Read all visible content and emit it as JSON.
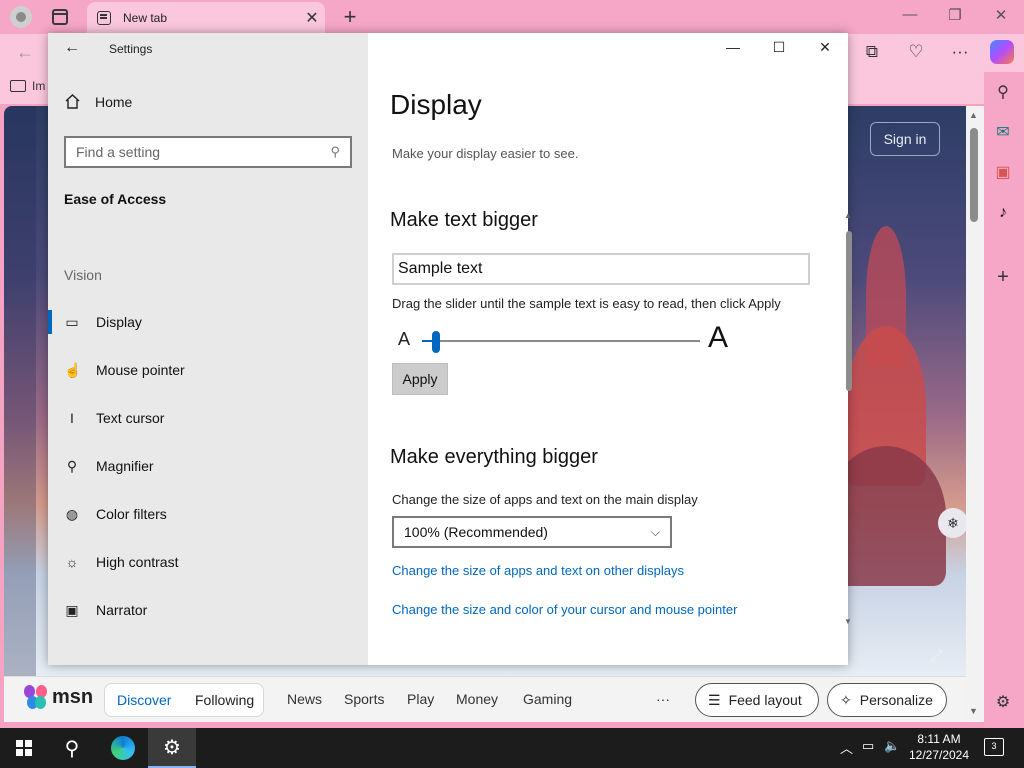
{
  "browser": {
    "tab_title": "New tab",
    "fav_label": "Im",
    "signin_label": "Sign in"
  },
  "msn": {
    "logo": "msn",
    "segments": [
      "Discover",
      "Following"
    ],
    "nav": [
      "News",
      "Sports",
      "Play",
      "Money",
      "Gaming"
    ],
    "more": "···",
    "feed_layout": "Feed layout",
    "personalize": "Personalize"
  },
  "settings": {
    "window_title": "Settings",
    "home_label": "Home",
    "search_placeholder": "Find a setting",
    "section": "Ease of Access",
    "group": "Vision",
    "nav_items": [
      {
        "label": "Display",
        "icon": "monitor-icon",
        "active": true
      },
      {
        "label": "Mouse pointer",
        "icon": "mouse-pointer-icon"
      },
      {
        "label": "Text cursor",
        "icon": "text-cursor-icon"
      },
      {
        "label": "Magnifier",
        "icon": "magnifier-icon"
      },
      {
        "label": "Color filters",
        "icon": "palette-icon"
      },
      {
        "label": "High contrast",
        "icon": "sun-icon"
      },
      {
        "label": "Narrator",
        "icon": "narrator-icon"
      }
    ],
    "page_title": "Display",
    "page_subtitle": "Make your display easier to see.",
    "text_bigger_heading": "Make text bigger",
    "sample_text": "Sample text",
    "slider_hint": "Drag the slider until the sample text is easy to read, then click Apply",
    "slider_small": "A",
    "slider_big": "A",
    "slider_value_fraction": 0.05,
    "apply_label": "Apply",
    "everything_bigger_heading": "Make everything bigger",
    "main_display_label": "Change the size of apps and text on the main display",
    "scale_value": "100% (Recommended)",
    "link_other_displays": "Change the size of apps and text on other displays",
    "link_cursor": "Change the size and color of your cursor and mouse pointer"
  },
  "taskbar": {
    "time": "8:11 AM",
    "date": "12/27/2024",
    "notification_count": "3"
  },
  "colors": {
    "accent": "#0067c0",
    "browser_pink": "#f6a6c6",
    "taskbar": "#1c1c1c"
  }
}
